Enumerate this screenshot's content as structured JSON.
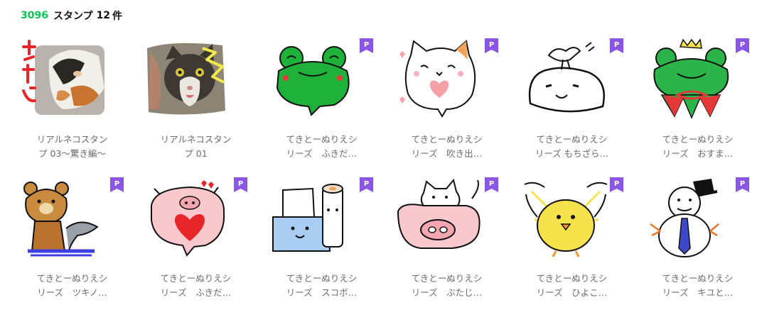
{
  "header": {
    "id": "3096",
    "word": "スタンプ",
    "count": "12",
    "unit": "件"
  },
  "badge_label": "P",
  "colors": {
    "accent": "#06c755",
    "premium": "#8b55e6",
    "text": "#6b6b6b"
  },
  "stickers": [
    {
      "line1": "リアルネコスタン",
      "line2": "プ 03〜驚き編〜",
      "image": "calico-cat-photo",
      "premium": false
    },
    {
      "line1": "リアルネコスタン",
      "line2": "プ 01",
      "image": "tabby-cat-photo",
      "premium": false
    },
    {
      "line1": "てきとーぬりえシ",
      "line2": "リーズ　ふきだ…",
      "image": "frog-speech-bubble",
      "premium": true
    },
    {
      "line1": "てきとーぬりえシ",
      "line2": "リーズ　吹き出…",
      "image": "cat-speech-bubble",
      "premium": true
    },
    {
      "line1": "てきとーぬりえシ",
      "line2": "リーズ もちざら…",
      "image": "mochi-seal-bird",
      "premium": true
    },
    {
      "line1": "てきとーぬりえシ",
      "line2": "リーズ　おすま…",
      "image": "frog-with-crown",
      "premium": true
    },
    {
      "line1": "てきとーぬりえシ",
      "line2": "リーズ　ツキノ…",
      "image": "bear-on-grass",
      "premium": true
    },
    {
      "line1": "てきとーぬりえシ",
      "line2": "リーズ　ふきだ…",
      "image": "pig-heart-bubble",
      "premium": true
    },
    {
      "line1": "てきとーぬりえシ",
      "line2": "リーズ　スコボ…",
      "image": "box-and-paper-roll",
      "premium": true
    },
    {
      "line1": "てきとーぬりえシ",
      "line2": "リーズ　ぶたじ…",
      "image": "pig-cushion-cat",
      "premium": true
    },
    {
      "line1": "てきとーぬりえシ",
      "line2": "リーズ　ひよこ…",
      "image": "yellow-chick",
      "premium": true
    },
    {
      "line1": "てきとーぬりえシ",
      "line2": "リーズ　キユと…",
      "image": "snowman-with-hat",
      "premium": true
    }
  ]
}
